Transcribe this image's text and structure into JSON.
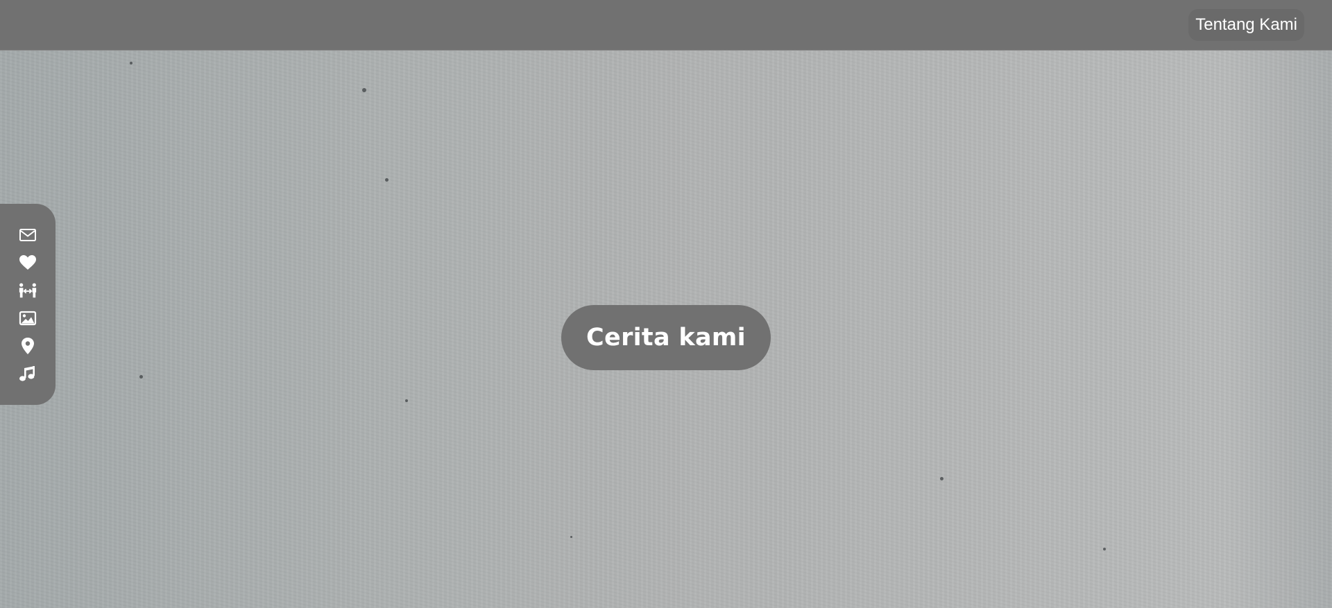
{
  "header": {
    "nav_link_label": "Tentang Kami"
  },
  "side_nav": {
    "items": [
      {
        "icon": "envelope-icon"
      },
      {
        "icon": "heart-icon"
      },
      {
        "icon": "couple-icon"
      },
      {
        "icon": "image-icon"
      },
      {
        "icon": "map-pin-icon"
      },
      {
        "icon": "music-note-icon"
      }
    ]
  },
  "hero": {
    "button_label": "Cerita kami"
  },
  "colors": {
    "bar_background": "#717171",
    "text": "#ffffff",
    "wall_background": "#adb1b1"
  }
}
